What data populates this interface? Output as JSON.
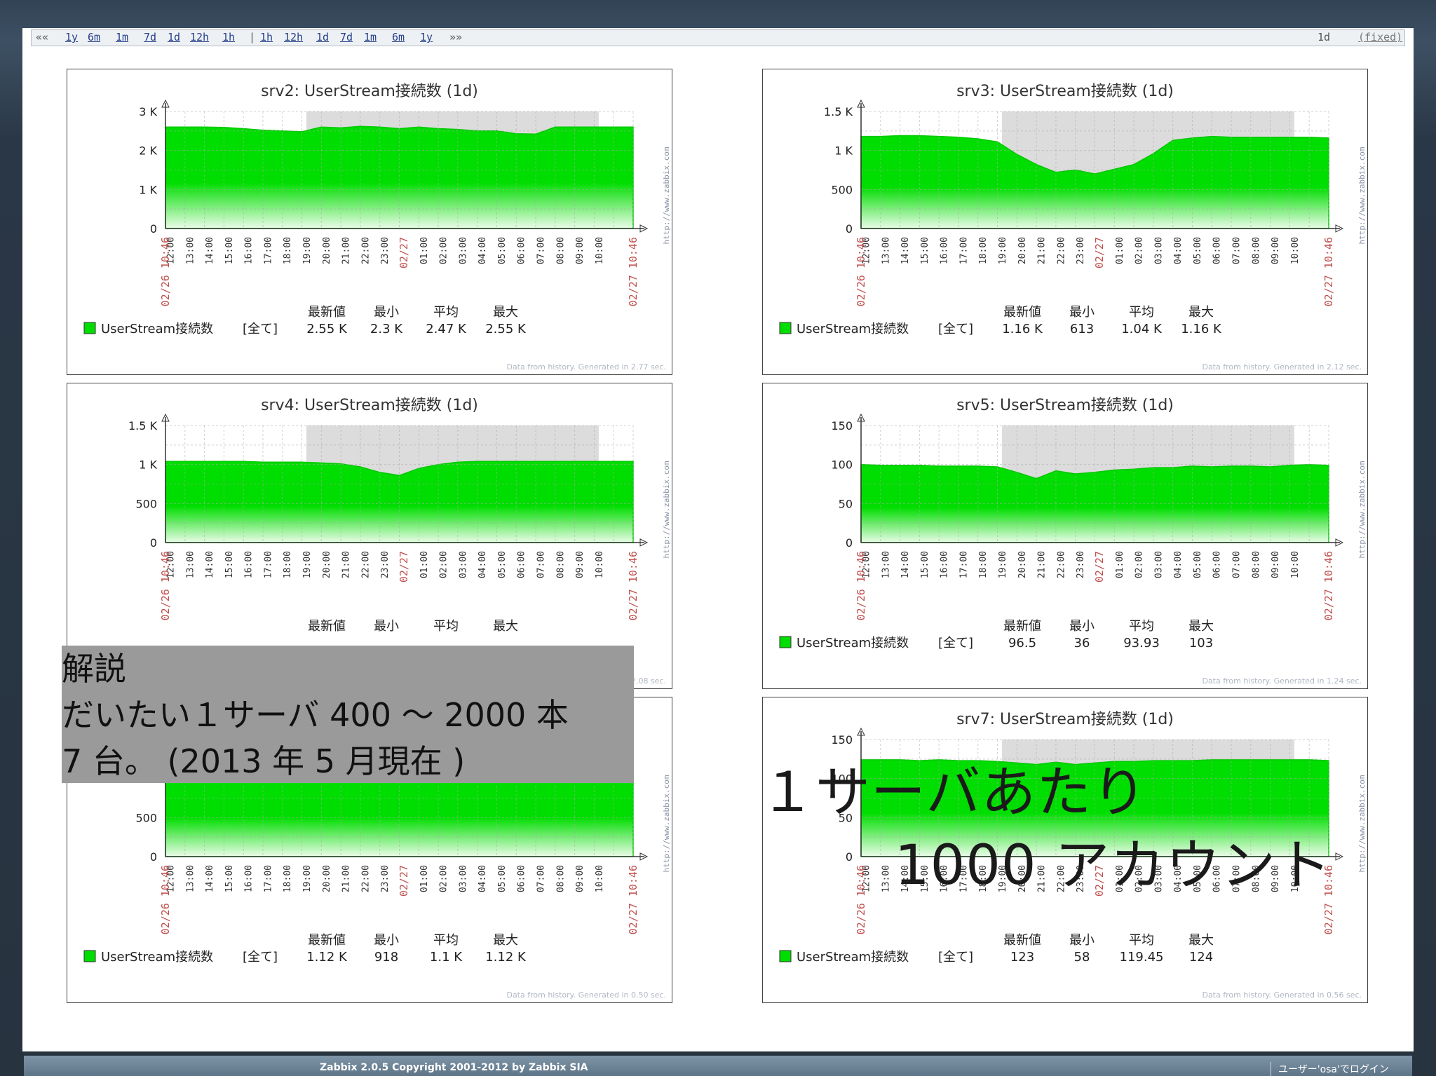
{
  "navbar": {
    "left_prev": "««",
    "left_links": [
      "1y",
      "6m",
      "1m",
      "7d",
      "1d",
      "12h",
      "1h"
    ],
    "separator": "|",
    "right_links": [
      "1h",
      "12h",
      "1d",
      "7d",
      "1m",
      "6m",
      "1y"
    ],
    "right_next": "»»",
    "period": "1d",
    "fixed": "(fixed)"
  },
  "common": {
    "xticks": [
      "12:00",
      "13:00",
      "14:00",
      "15:00",
      "16:00",
      "17:00",
      "18:00",
      "19:00",
      "20:00",
      "21:00",
      "22:00",
      "23:00",
      "02/27",
      "01:00",
      "02:00",
      "03:00",
      "04:00",
      "05:00",
      "06:00",
      "07:00",
      "08:00",
      "09:00",
      "10:00"
    ],
    "start_label": "02/26 10:46",
    "end_label": "02/27 10:46",
    "side_label": "http://www.zabbix.com",
    "legend_name": "UserStream接続数",
    "legend_all": "[全て]",
    "stat_headers": [
      "最新値",
      "最小",
      "平均",
      "最大"
    ],
    "series_color": "#00dd00",
    "night_color": "#dcdcdc"
  },
  "graphs": [
    {
      "title": "srv2: UserStream接続数 (1d)",
      "yticks": [
        "3 K",
        "2 K",
        "1 K",
        "0"
      ],
      "ymax": 3000,
      "values": [
        2600,
        2600,
        2600,
        2590,
        2560,
        2520,
        2500,
        2480,
        2600,
        2580,
        2620,
        2600,
        2560,
        2600,
        2560,
        2540,
        2500,
        2500,
        2430,
        2420,
        2600,
        2600,
        2600,
        2600,
        2600
      ],
      "stats": [
        "2.55 K",
        "2.3 K",
        "2.47 K",
        "2.55 K"
      ],
      "generated": "Data from history. Generated in 2.77 sec."
    },
    {
      "title": "srv3: UserStream接続数 (1d)",
      "yticks": [
        "1.5 K",
        "1 K",
        "500",
        "0"
      ],
      "ymax": 1500,
      "values": [
        1180,
        1180,
        1190,
        1190,
        1180,
        1170,
        1150,
        1110,
        950,
        820,
        720,
        750,
        700,
        760,
        820,
        960,
        1130,
        1160,
        1180,
        1170,
        1170,
        1170,
        1170,
        1170,
        1160
      ],
      "stats": [
        "1.16 K",
        "613",
        "1.04 K",
        "1.16 K"
      ],
      "generated": "Data from history. Generated in 2.12 sec."
    },
    {
      "title": "srv4: UserStream接続数 (1d)",
      "yticks": [
        "1.5 K",
        "1 K",
        "500",
        "0"
      ],
      "ymax": 1500,
      "values": [
        1040,
        1040,
        1040,
        1040,
        1040,
        1030,
        1030,
        1030,
        1020,
        1010,
        970,
        900,
        860,
        950,
        1000,
        1030,
        1040,
        1040,
        1040,
        1040,
        1040,
        1040,
        1040,
        1040,
        1040
      ],
      "stats": [],
      "generated": "Data from history. Generated in 2.08 sec."
    },
    {
      "title": "srv5: UserStream接続数 (1d)",
      "yticks": [
        "150",
        "100",
        "50",
        "0"
      ],
      "ymax": 150,
      "values": [
        100,
        99,
        99,
        99,
        98,
        98,
        98,
        97,
        90,
        82,
        92,
        88,
        90,
        93,
        94,
        96,
        96,
        98,
        97,
        98,
        98,
        97,
        99,
        100,
        99
      ],
      "stats": [
        "96.5",
        "36",
        "93.93",
        "103"
      ],
      "generated": "Data from history. Generated in 1.24 sec."
    },
    {
      "title": "",
      "yticks": [
        "",
        "",
        "500",
        "0"
      ],
      "ymax": 1500,
      "values": [
        1100,
        1100,
        1100,
        1110,
        1110,
        1110,
        1110,
        1110,
        1100,
        1100,
        1100,
        1100,
        1110,
        1110,
        1110,
        1110,
        1110,
        1110,
        1110,
        1110,
        1110,
        1110,
        1110,
        1120,
        1120
      ],
      "stats": [
        "1.12 K",
        "918",
        "1.1 K",
        "1.12 K"
      ],
      "generated": "Data from history. Generated in 0.50 sec."
    },
    {
      "title": "srv7: UserStream接続数 (1d)",
      "yticks": [
        "150",
        "100",
        "50",
        "0"
      ],
      "ymax": 150,
      "values": [
        124,
        124,
        124,
        123,
        124,
        123,
        123,
        122,
        120,
        118,
        121,
        118,
        120,
        122,
        122,
        123,
        123,
        123,
        124,
        124,
        124,
        124,
        124,
        124,
        123
      ],
      "stats": [
        "123",
        "58",
        "119.45",
        "124"
      ],
      "generated": "Data from history. Generated in 0.56 sec."
    }
  ],
  "note": {
    "heading": "解説",
    "line1": "だいたい１サーバ 400 〜 2000 本",
    "line2": "7 台。 (2013 年 5 月現在 )"
  },
  "callout": {
    "line1": "１サーバあたり",
    "line2": "1000 アカウント"
  },
  "footer": {
    "copyright": "Zabbix 2.0.5 Copyright 2001-2012 by Zabbix SIA",
    "login": "ユーザー'osa'でログイン"
  }
}
